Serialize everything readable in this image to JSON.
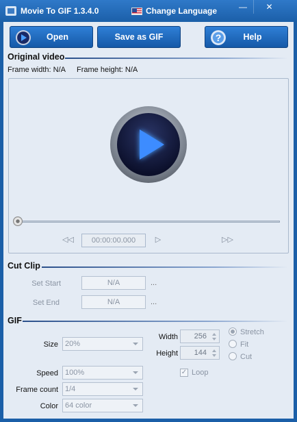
{
  "window": {
    "title": "Movie To GIF 1.3.4.0",
    "language_label": "Change Language",
    "minimize_glyph": "—",
    "close_glyph": "✕"
  },
  "toolbar": {
    "open_label": "Open",
    "save_label": "Save as GIF",
    "help_label": "Help",
    "help_glyph": "?"
  },
  "original_video": {
    "heading": "Original video",
    "frame_width": "Frame width: N/A",
    "frame_height": "Frame height: N/A",
    "time": "00:00:00.000",
    "seek_position": 0,
    "prev_glyph": "◁◁",
    "play_glyph": "▷",
    "next_glyph": "▷▷"
  },
  "cut_clip": {
    "heading": "Cut Clip",
    "set_start_label": "Set Start",
    "set_start_value": "N/A",
    "set_end_label": "Set End",
    "set_end_value": "N/A",
    "browse": "..."
  },
  "gif": {
    "heading": "GIF",
    "size_label": "Size",
    "size_value": "20%",
    "width_label": "Width",
    "width_value": "256",
    "height_label": "Height",
    "height_value": "144",
    "resize_options": [
      "Stretch",
      "Fit",
      "Cut"
    ],
    "resize_selected": "Stretch",
    "loop_label": "Loop",
    "loop_checked": true,
    "speed_label": "Speed",
    "speed_value": "100%",
    "frame_count_label": "Frame count",
    "frame_count_value": "1/4",
    "color_label": "Color",
    "color_value": "64 color"
  }
}
